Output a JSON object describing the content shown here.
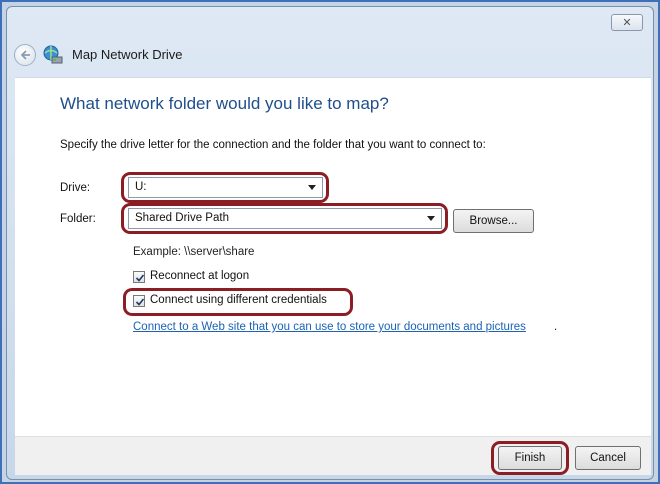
{
  "window": {
    "title": "Map Network Drive",
    "close_glyph": "✕"
  },
  "icons": {
    "back": "back-arrow-icon",
    "network": "network-drive-icon",
    "close": "close-icon",
    "dropdown": "chevron-down-icon",
    "check": "checkmark-icon"
  },
  "main": {
    "heading": "What network folder would you like to map?",
    "instruction": "Specify the drive letter for the connection and the folder that you want to connect to:",
    "drive_label": "Drive:",
    "drive_value": "U:",
    "folder_label": "Folder:",
    "folder_value": "Shared Drive Path",
    "browse_label": "Browse...",
    "example": "Example: \\\\server\\share",
    "reconnect_label": "Reconnect at logon",
    "reconnect_checked": true,
    "credentials_label": "Connect using different credentials",
    "credentials_checked": true,
    "link_text": "Connect to a Web site that you can use to store your documents and pictures",
    "link_suffix": "."
  },
  "footer": {
    "finish_label": "Finish",
    "cancel_label": "Cancel"
  },
  "colors": {
    "heading": "#1e4e8c",
    "link": "#1a63b5",
    "highlight": "#8a1e24",
    "frame": "#3f6fb6"
  }
}
